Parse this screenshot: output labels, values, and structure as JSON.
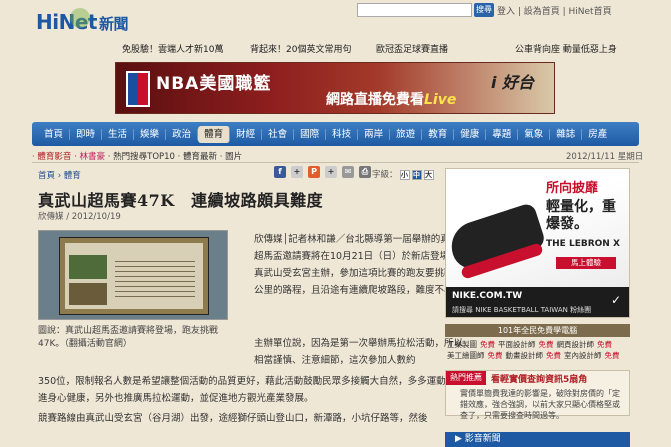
{
  "header": {
    "logo_text": "HiNet",
    "logo_sub": "新聞",
    "search_button": "搜尋",
    "top_links": "登入 | 設為首頁 | HiNet首頁"
  },
  "headline_links": [
    {
      "text": "免股驗！雲端人才新10萬"
    },
    {
      "text": "背起來！20個英文常用句"
    },
    {
      "text": "歐冠盃足球賽直播"
    },
    {
      "text": "公車背向座 動量低惡上身"
    }
  ],
  "banner": {
    "title": "NBA美國職籃",
    "tagline_plain": "網路直播免費看",
    "tagline_em": "Live",
    "slogan": "i 好台"
  },
  "nav": {
    "items": [
      "首頁",
      "即時",
      "生活",
      "娛樂",
      "政治",
      "體育",
      "財經",
      "社會",
      "國際",
      "科技",
      "兩岸",
      "旅遊",
      "教育",
      "健康",
      "專題",
      "氣象",
      "雜誌",
      "房產"
    ],
    "active": "體育"
  },
  "subnav": {
    "video": "‧ 體育影音",
    "lin": "‧ 林書豪",
    "top10": "‧ 熱門搜尋TOP10",
    "latest": "‧ 體育最新",
    "photos": "‧ 圖片"
  },
  "date": "2012/11/11 星期日",
  "breadcrumb": "首頁 › 體育",
  "font_size": {
    "label": "字級：",
    "a": "小",
    "b": "中",
    "c": "大"
  },
  "article": {
    "title": "真武山超馬賽47K　連續坡路頗具難度",
    "byline": "欣傳媒 / 2012/10/19",
    "caption": "圖說：真武山超馬盃邀請賽將登場，跑友挑戰47K。（翻攝活動官網）",
    "p1": "欣傳媒│記者林和謙／台北縣導第一屆舉辦的真武山超馬盃邀請賽將在10月21日（日）於新店登場，由真武山受玄宮主辦，參加這項比賽的跑友要挑戰47公里的路程，且沿途有連續爬坡路段，難度不小。",
    "p2": "主辦單位說，因為是第一次舉辦馬拉松活動，所以相當謹慎、注意細節，這次參加人數約",
    "p3": "350位，限制報名人數是希望讓整個活動的品質更好，藉此活動鼓勵民眾多接觸大自然，多多運動，促進身心健康，另外也推廣馬拉松運動，並促進地方觀光產業發展。",
    "p4": "競賽路線由真武山受玄宮（谷月湖）出發，途經獅仔頭山登山口，新潭路，小坑仔路等，然後"
  },
  "ad": {
    "line1": "所向披靡",
    "line2": "輕量化，重爆發。",
    "line3": "THE LEBRON X",
    "button": "馬上體驗",
    "site": "NIKE.COM.TW",
    "store": "請搜尋 NIKE BASKETBALL TAIWAN 粉絲團"
  },
  "exam": {
    "header": "101年全民免費學電腦",
    "rows": [
      [
        "工業製圖",
        "免費",
        "平面設計師",
        "免費",
        "網頁設計師",
        "免費"
      ],
      [
        "美工繪圖師",
        "免費",
        "動畫設計師",
        "免費",
        "室內設計師",
        "免費"
      ]
    ]
  },
  "hot": {
    "tag": "熱門推薦",
    "title": "看輕實價查詢資訊5扇角",
    "text": "實價單簡費我達的影響是，破除對房價的「定錯效應，強合強調，以前大家只顯心價格堅或查了，只需要搜查時間過等。"
  },
  "video_section": "影音新聞",
  "colors": {
    "nav_blue": "#1d5aa3",
    "accent_red": "#c8102e",
    "bg": "#efe7d6"
  }
}
